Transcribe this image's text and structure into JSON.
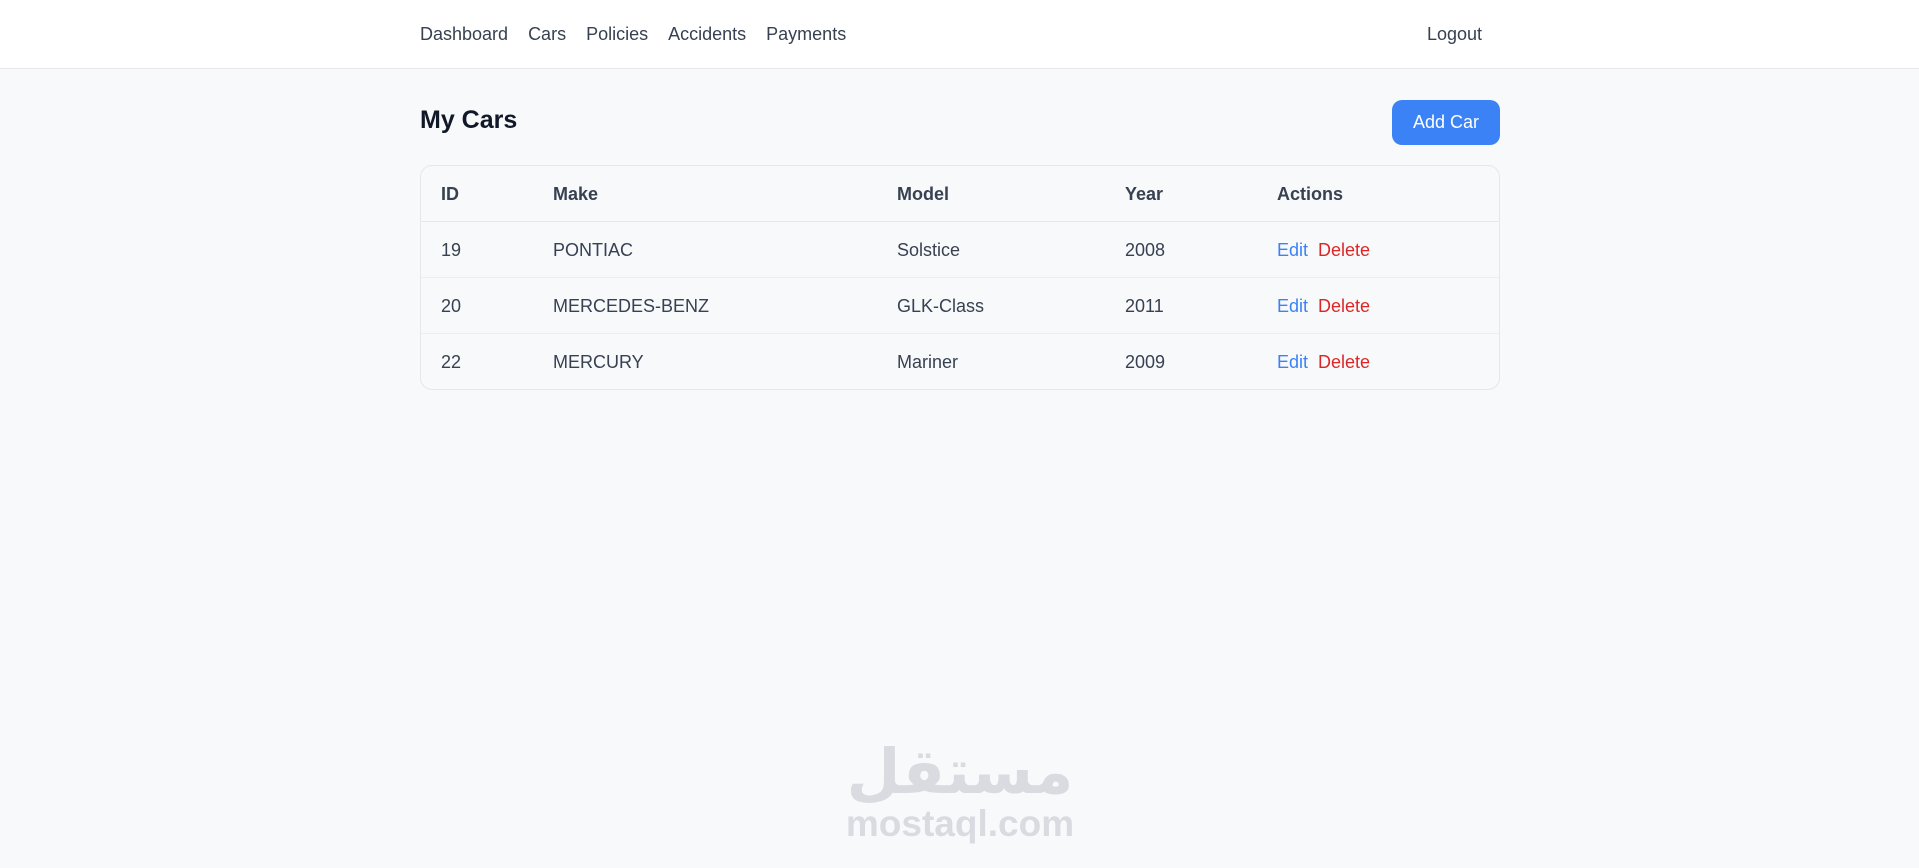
{
  "nav": {
    "items": [
      {
        "label": "Dashboard"
      },
      {
        "label": "Cars"
      },
      {
        "label": "Policies"
      },
      {
        "label": "Accidents"
      },
      {
        "label": "Payments"
      }
    ],
    "logout_label": "Logout"
  },
  "page": {
    "title": "My Cars",
    "add_button_label": "Add Car"
  },
  "table": {
    "headers": [
      "ID",
      "Make",
      "Model",
      "Year",
      "Actions"
    ],
    "rows": [
      {
        "id": "19",
        "make": "PONTIAC",
        "model": "Solstice",
        "year": "2008",
        "edit": "Edit",
        "delete": "Delete"
      },
      {
        "id": "20",
        "make": "MERCEDES-BENZ",
        "model": "GLK-Class",
        "year": "2011",
        "edit": "Edit",
        "delete": "Delete"
      },
      {
        "id": "22",
        "make": "MERCURY",
        "model": "Mariner",
        "year": "2009",
        "edit": "Edit",
        "delete": "Delete"
      }
    ]
  },
  "watermark": {
    "logo_text": "مستقل",
    "domain": "mostaql.com"
  },
  "colors": {
    "accent": "#3b82f6",
    "danger": "#dc2626",
    "background": "#f8f9fb"
  }
}
